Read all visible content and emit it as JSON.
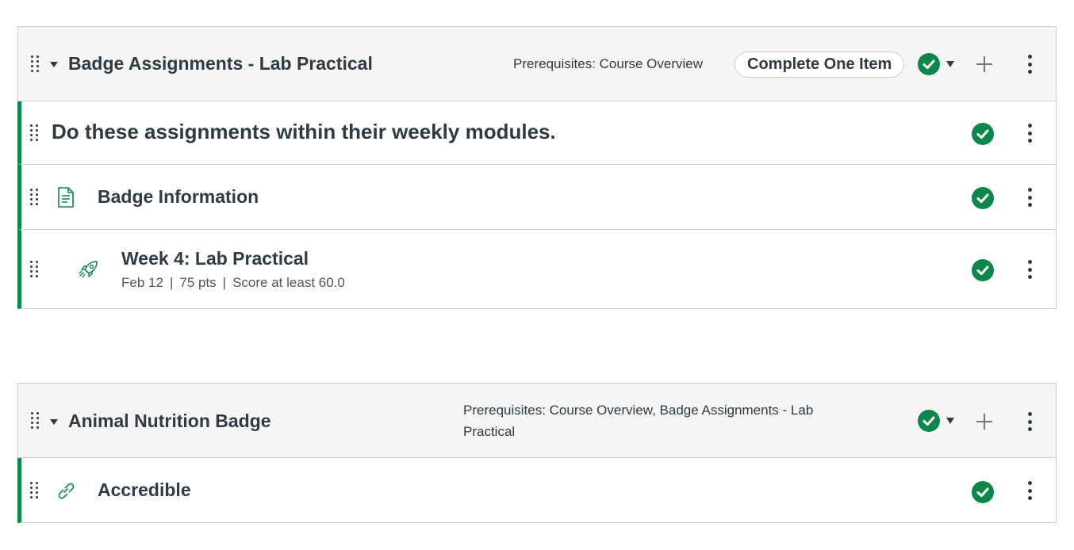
{
  "modules": [
    {
      "title": "Badge Assignments - Lab Practical",
      "prerequisites": "Prerequisites: Course Overview",
      "requirement": "Complete One Item",
      "items": [
        {
          "type": "subheader",
          "label": "Do these assignments within their weekly modules."
        },
        {
          "type": "page",
          "icon": "document-icon",
          "label": "Badge Information"
        },
        {
          "type": "assignment",
          "icon": "rocket-icon",
          "label": "Week 4: Lab Practical",
          "meta": {
            "date": "Feb 12",
            "sep1": "|",
            "points": "75 pts",
            "sep2": "|",
            "requirement": "Score at least 60.0"
          }
        }
      ]
    },
    {
      "title": "Animal Nutrition Badge",
      "prerequisites_line1": "Prerequisites: Course Overview, Badge Assignments - Lab",
      "prerequisites_line2": "Practical",
      "items": [
        {
          "type": "link",
          "icon": "link-icon",
          "label": "Accredible"
        }
      ]
    }
  ],
  "colors": {
    "published": "#0b874b",
    "text": "#2d3b45",
    "header_bg": "#f5f5f5",
    "border": "#c7cdd1"
  }
}
